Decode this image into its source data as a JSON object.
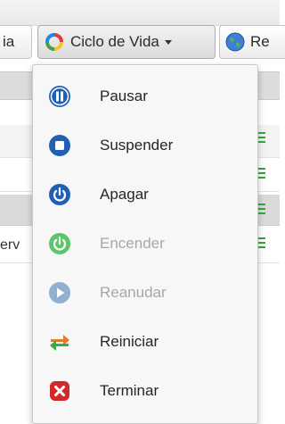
{
  "toolbar": {
    "prev_label": "ia",
    "ciclo_label": "Ciclo de Vida",
    "next_label": "Re"
  },
  "table": {
    "partial_cell": "erv"
  },
  "menu": {
    "items": [
      {
        "label": "Pausar",
        "enabled": true,
        "icon": "pause-icon"
      },
      {
        "label": "Suspender",
        "enabled": true,
        "icon": "stop-icon"
      },
      {
        "label": "Apagar",
        "enabled": true,
        "icon": "power-icon"
      },
      {
        "label": "Encender",
        "enabled": false,
        "icon": "power-on-icon"
      },
      {
        "label": "Reanudar",
        "enabled": false,
        "icon": "play-icon"
      },
      {
        "label": "Reiniciar",
        "enabled": true,
        "icon": "restart-icon"
      },
      {
        "label": "Terminar",
        "enabled": true,
        "icon": "terminate-icon"
      }
    ]
  },
  "colors": {
    "accent_blue": "#1f5fb5",
    "disabled_green": "#5cc66a",
    "disabled_blue": "#8fb0d0",
    "terminate_red": "#d22a2a"
  }
}
